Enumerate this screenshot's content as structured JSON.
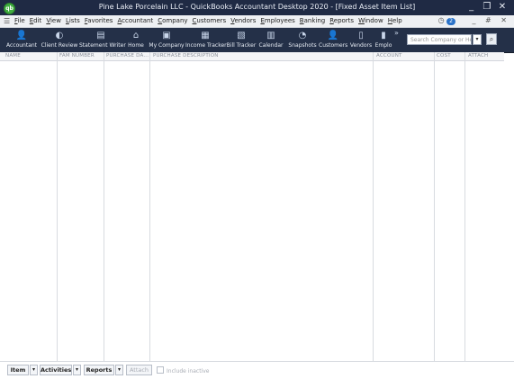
{
  "window": {
    "title": "Pine Lake Porcelain LLC  - QuickBooks Accountant Desktop 2020 - [Fixed Asset Item List]",
    "app_icon_text": "qb",
    "min_glyph": "_",
    "restore_glyph": "❐",
    "close_glyph": "✕"
  },
  "menubar": {
    "items": [
      "File",
      "Edit",
      "View",
      "Lists",
      "Favorites",
      "Accountant",
      "Company",
      "Customers",
      "Vendors",
      "Employees",
      "Banking",
      "Reports",
      "Window",
      "Help"
    ],
    "badge": "2",
    "child_min": "_",
    "child_restore": "#",
    "child_close": "✕"
  },
  "toolbar": {
    "tools": [
      {
        "label": "Accountant",
        "icon": "accountant-icon",
        "glyph": "👤"
      },
      {
        "label": "Client Review",
        "icon": "client-review-icon",
        "glyph": "◐"
      },
      {
        "label": "Statement Writer",
        "icon": "statement-writer-icon",
        "glyph": "▤"
      },
      {
        "label": "Home",
        "icon": "home-icon",
        "glyph": "⌂"
      },
      {
        "label": "My Company",
        "icon": "my-company-icon",
        "glyph": "▣"
      },
      {
        "label": "Income Tracker",
        "icon": "income-tracker-icon",
        "glyph": "▦"
      },
      {
        "label": "Bill Tracker",
        "icon": "bill-tracker-icon",
        "glyph": "▧"
      },
      {
        "label": "Calendar",
        "icon": "calendar-icon",
        "glyph": "▥"
      },
      {
        "label": "Snapshots",
        "icon": "snapshots-icon",
        "glyph": "◔"
      },
      {
        "label": "Customers",
        "icon": "customers-icon",
        "glyph": "👤"
      },
      {
        "label": "Vendors",
        "icon": "vendors-icon",
        "glyph": "▯"
      },
      {
        "label": "Emplo",
        "icon": "employees-icon",
        "glyph": "▮"
      }
    ],
    "more_glyph": "»",
    "search_placeholder": "Search Company or Help",
    "search_drop_glyph": "▾",
    "search_go_glyph": "⌕"
  },
  "table": {
    "columns": [
      "NAME",
      "FAM NUMBER",
      "PURCHASE DA...",
      "PURCHASE DESCRIPTION",
      "ACCOUNT",
      "COST",
      "ATTACH"
    ]
  },
  "bottom": {
    "item_label": "Item",
    "activities_label": "Activities",
    "reports_label": "Reports",
    "attach_label": "Attach",
    "drop_glyph": "▾",
    "include_inactive_label": "Include inactive"
  }
}
